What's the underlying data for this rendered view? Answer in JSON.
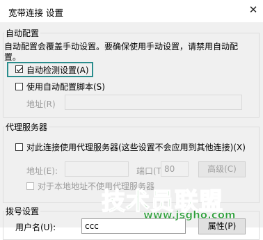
{
  "window": {
    "title": "宽带连接 设置",
    "close_glyph": "✕"
  },
  "auto_config": {
    "legend": "自动配置",
    "description_line1": "自动配置会覆盖手动设置。要确保使用手动设置，请禁用自动配",
    "description_line2": "置。",
    "auto_detect": {
      "label": "自动检测设置(A)",
      "checked": true
    },
    "use_script": {
      "label": "使用自动配置脚本(S)",
      "checked": false
    },
    "address_label": "地址(R)",
    "address_value": ""
  },
  "proxy": {
    "legend": "代理服务器",
    "use_proxy": {
      "label": "对此连接使用代理服务器(这些设置不会应用到其他连接)(X)",
      "checked": false
    },
    "address_label": "地址(E):",
    "address_value": "",
    "port_label": "端口(T):",
    "port_value": "80",
    "advanced_button": "高级(C)",
    "bypass_local": {
      "label": "对于本地地址不使用代理服务器",
      "checked": false
    }
  },
  "dialup": {
    "legend": "拨号设置",
    "username_label": "用户名(U):",
    "username_value": "ccc",
    "properties_button": "属性(P)"
  },
  "watermark": {
    "text": "技术员联盟",
    "url": "www.jsgho.com",
    "colors": {
      "main": "#2e9e3a",
      "outline": "#ffffff"
    }
  },
  "colors": {
    "focus_ring": "#2a8d8d",
    "dialog_bg": "#f0f0f0"
  }
}
